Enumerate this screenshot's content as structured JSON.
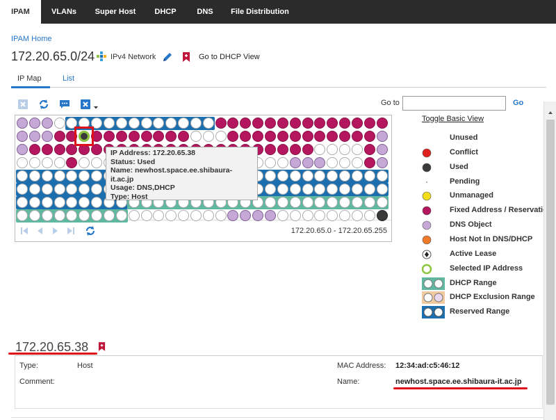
{
  "nav": {
    "tabs": [
      {
        "label": "IPAM",
        "active": true
      },
      {
        "label": "VLANs"
      },
      {
        "label": "Super Host"
      },
      {
        "label": "DHCP"
      },
      {
        "label": "DNS"
      },
      {
        "label": "File Distribution"
      }
    ]
  },
  "breadcrumb": "IPAM Home",
  "network": {
    "address": "172.20.65.0/24",
    "type_label": "IPv4 Network",
    "dhcp_view_link": "Go to DHCP View"
  },
  "view_tabs": {
    "ip_map": "IP Map",
    "list": "List"
  },
  "goto": {
    "label": "Go to",
    "value": "",
    "button": "Go"
  },
  "toggle_basic_view": "Toggle Basic View",
  "range_label": "172.20.65.0 - 172.20.65.255",
  "tooltip": {
    "ip": "IP Address: 172.20.65.38",
    "status": "Status: Used",
    "name": "Name: newhost.space.ee.shibaura-it.ac.jp",
    "usage": "Usage: DNS,DHCP",
    "type": "Type: Host"
  },
  "legend": [
    {
      "label": "Unused",
      "icon": "none"
    },
    {
      "label": "Conflict",
      "icon": "red-dot",
      "color": "#e0201e"
    },
    {
      "label": "Used",
      "icon": "dark-dot",
      "color": "#3a3a3a"
    },
    {
      "label": "Pending",
      "icon": "small-dot"
    },
    {
      "label": "Unmanaged",
      "icon": "yellow-dot",
      "color": "#f2df1a"
    },
    {
      "label": "Fixed Address / Reservation",
      "icon": "magenta-dot",
      "color": "#b5175f"
    },
    {
      "label": "DNS Object",
      "icon": "lavender-dot",
      "color": "#c6a8d6"
    },
    {
      "label": "Host Not In DNS/DHCP",
      "icon": "orange-dot",
      "color": "#ee7a2a"
    },
    {
      "label": "Active Lease",
      "icon": "diamond-dot"
    },
    {
      "label": "Selected IP Address",
      "icon": "green-ring",
      "color": "#8cc63e"
    },
    {
      "label": "DHCP Range",
      "icon": "teal-range",
      "color": "#5fb9a0"
    },
    {
      "label": "DHCP Exclusion Range",
      "icon": "exclusion-range",
      "color": "#f0c9a0"
    },
    {
      "label": "Reserved Range",
      "icon": "blue-range",
      "color": "#1b6faf"
    }
  ],
  "selected_ip": {
    "address": "172.20.65.38",
    "type_label": "Type:",
    "type_value": "Host",
    "comment_label": "Comment:",
    "mac_label": "MAC Address:",
    "mac_value": "12:34:ad:c5:46:12",
    "name_label": "Name:",
    "name_value": "newhost.space.ee.shibaura-it.ac.jp"
  },
  "colors": {
    "magenta": "#b5175f",
    "lavender": "#c6a8d6",
    "reserved": "#1b6faf",
    "dhcp": "#5fb9a0",
    "used": "#3a3a3a",
    "selected": "#8cc63e",
    "highlight": "#e0101a"
  }
}
